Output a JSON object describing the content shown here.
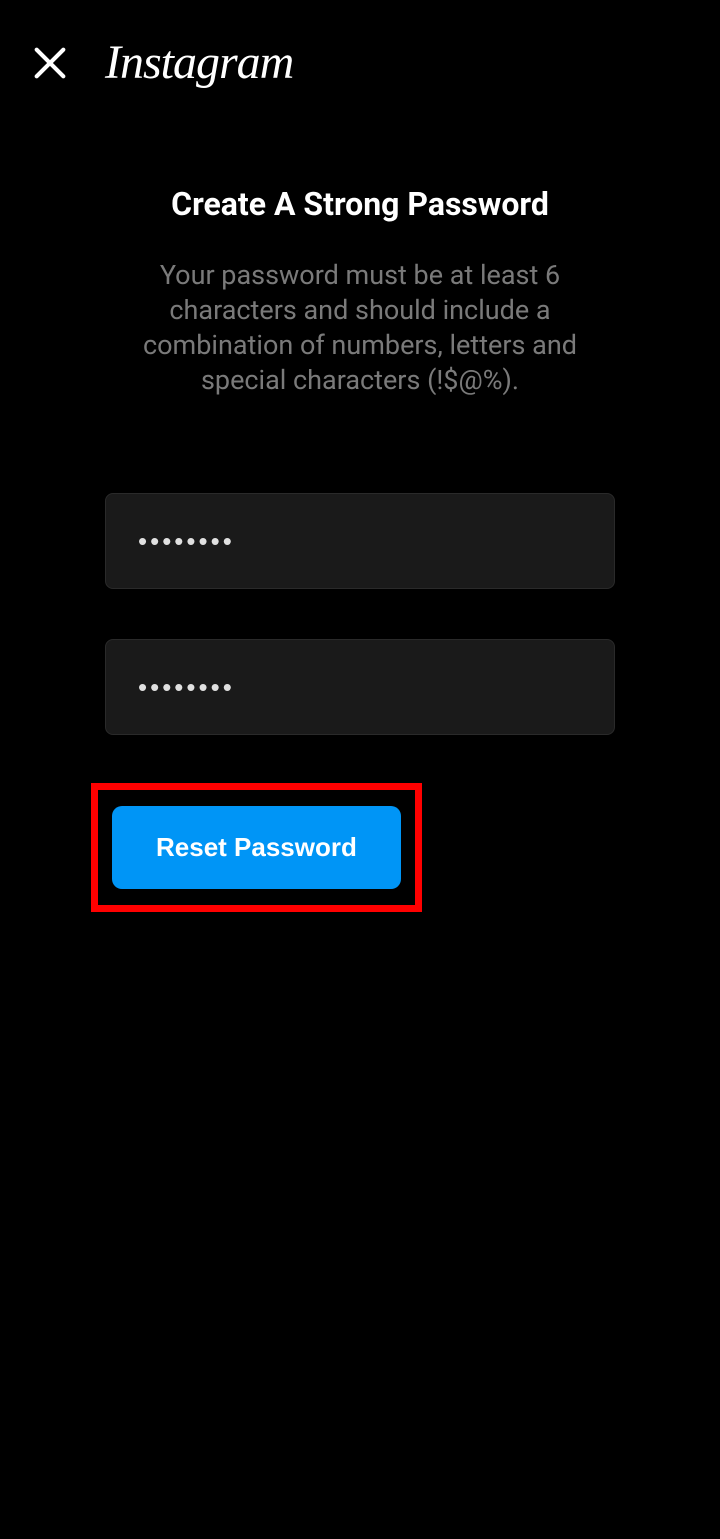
{
  "header": {
    "logo_text": "Instagram"
  },
  "content": {
    "title": "Create A Strong Password",
    "subtitle": "Your password must be at least 6 characters and should include a combination of numbers, letters and special characters (!$@%)."
  },
  "form": {
    "password_value": "••••••••",
    "confirm_password_value": "••••••••",
    "reset_button_label": "Reset Password"
  },
  "highlight": {
    "target": "reset-button",
    "color": "#ff0000"
  }
}
